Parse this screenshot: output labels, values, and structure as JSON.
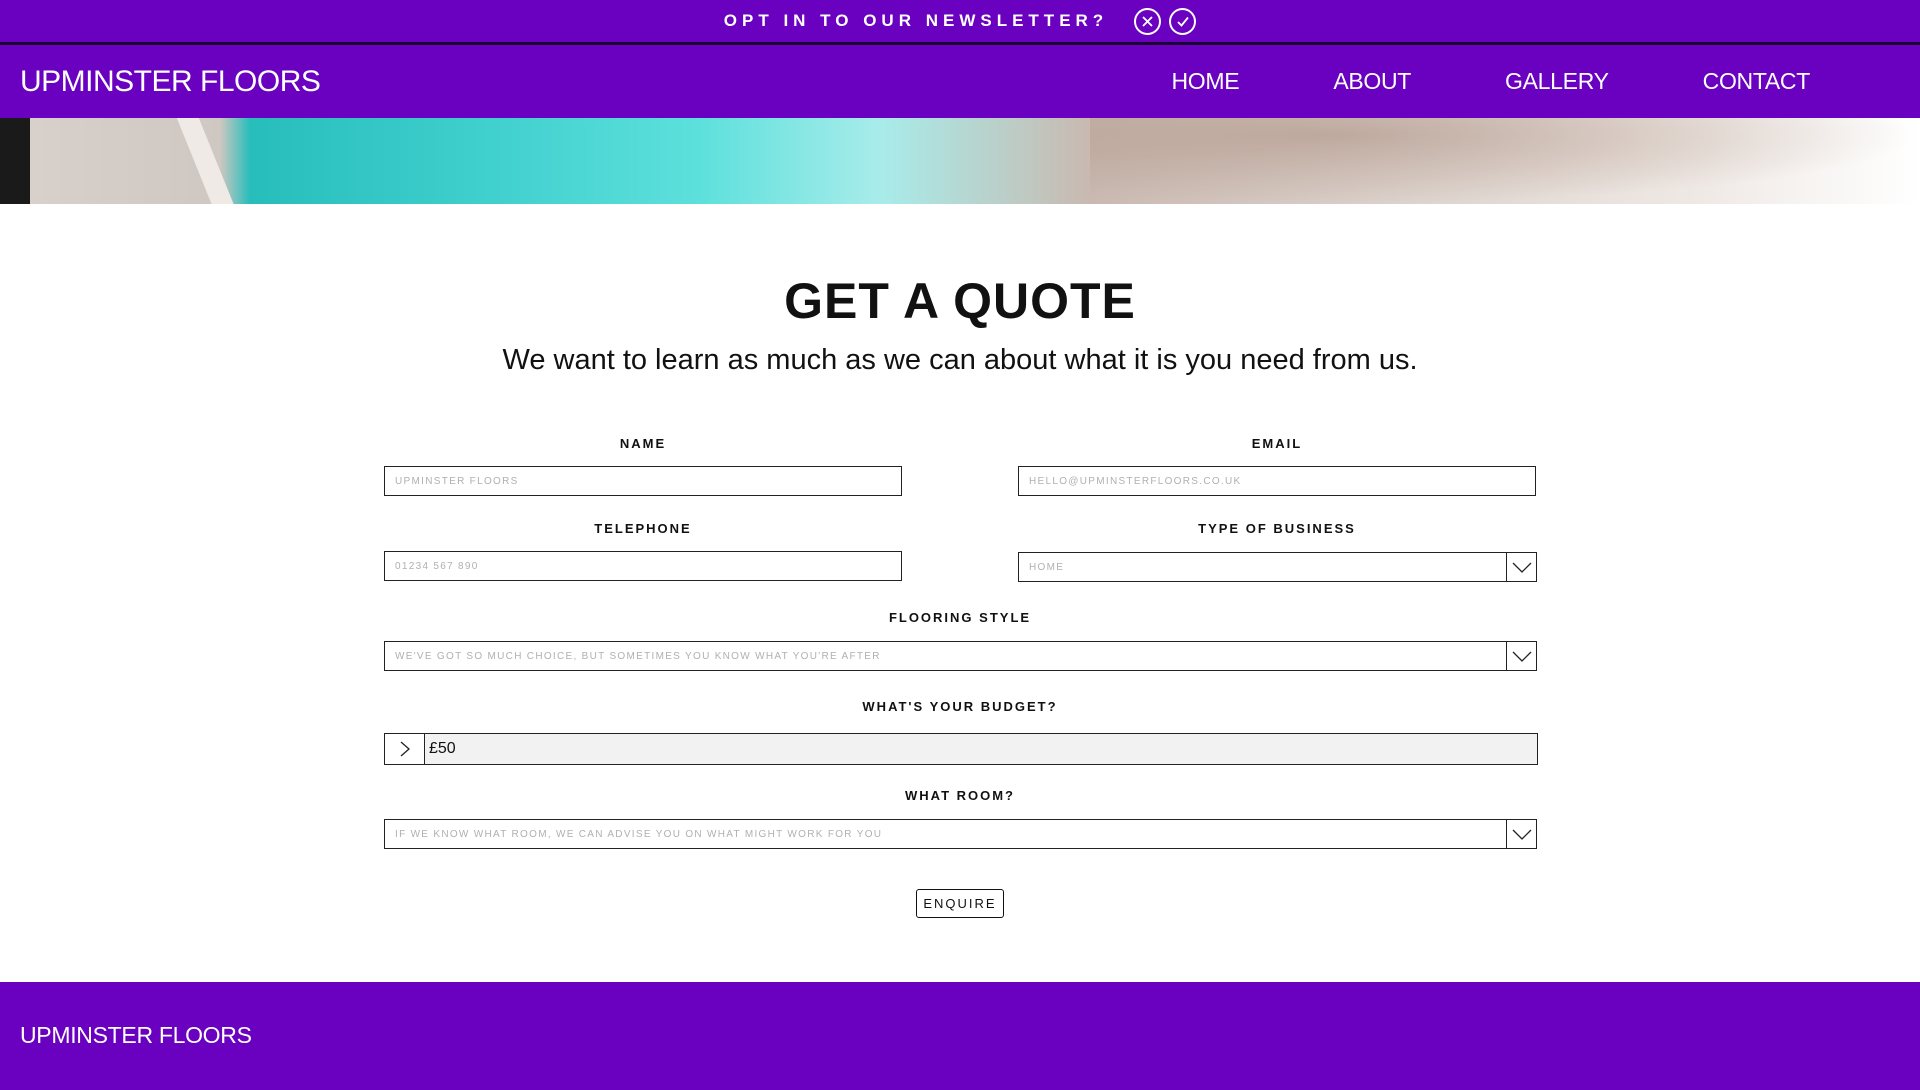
{
  "topbar": {
    "text": "OPT IN TO OUR NEWSLETTER?",
    "decline_icon": "close-circle-icon",
    "accept_icon": "check-circle-icon"
  },
  "header": {
    "logo": "UPMINSTER FLOORS",
    "nav": [
      {
        "label": "HOME"
      },
      {
        "label": "ABOUT"
      },
      {
        "label": "GALLERY"
      },
      {
        "label": "CONTACT"
      }
    ]
  },
  "main": {
    "title": "GET A QUOTE",
    "subtitle": "We want to learn as much as we can about what it is you need from us."
  },
  "form": {
    "name": {
      "label": "NAME",
      "placeholder": "UPMINSTER FLOORS"
    },
    "email": {
      "label": "EMAIL",
      "placeholder": "HELLO@UPMINSTERFLOORS.CO.UK"
    },
    "telephone": {
      "label": "TELEPHONE",
      "placeholder": "01234 567 890"
    },
    "business": {
      "label": "TYPE OF BUSINESS",
      "value": "HOME"
    },
    "flooring": {
      "label": "FLOORING STYLE",
      "value": "WE'VE GOT SO MUCH CHOICE, BUT SOMETIMES YOU KNOW WHAT YOU'RE AFTER"
    },
    "budget": {
      "label": "WHAT'S YOUR BUDGET?",
      "value": "£50"
    },
    "room": {
      "label": "WHAT ROOM?",
      "value": "IF WE KNOW WHAT ROOM, WE CAN ADVISE YOU ON WHAT MIGHT WORK FOR YOU"
    },
    "submit_label": "ENQUIRE"
  },
  "footer": {
    "logo": "UPMINSTER FLOORS"
  },
  "colors": {
    "brand_purple": "#6a00c0",
    "accent_teal": "#3fcfcd"
  }
}
